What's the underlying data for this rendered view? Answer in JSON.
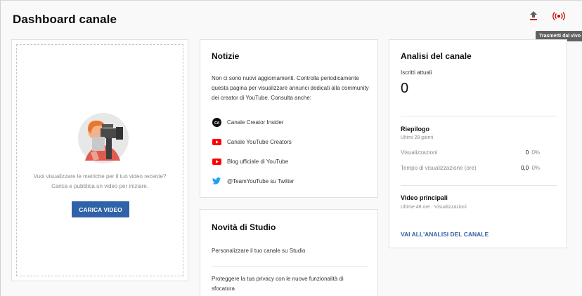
{
  "header": {
    "title": "Dashboard canale",
    "upload_icon": "upload-icon",
    "live_icon": "live-broadcast-icon",
    "tooltip": "Trasmetti dal vivo"
  },
  "video_card": {
    "empty_line1": "Vuoi visualizzare le metriche per il tuo video recente?",
    "empty_line2": "Carica e pubblica un video per iniziare.",
    "upload_button": "CARICA VIDEO"
  },
  "news_card": {
    "title": "Notizie",
    "body": "Non ci sono nuovi aggiornamenti. Controlla periodicamente questa pagina per visualizzare annunci dedicati alla community dei creator di YouTube. Consulta anche:",
    "links": [
      {
        "label": "Canale Creator Insider",
        "icon": "creator-insider-icon"
      },
      {
        "label": "Canale YouTube Creators",
        "icon": "youtube-icon"
      },
      {
        "label": "Blog ufficiale di YouTube",
        "icon": "youtube-icon"
      },
      {
        "label": "@TeamYouTube su Twitter",
        "icon": "twitter-icon"
      }
    ]
  },
  "studio_card": {
    "title": "Novità di Studio",
    "items": [
      "Personalizzare il tuo canale su Studio",
      "Proteggere la tua privacy con le nuove funzionalità di sfocatura"
    ]
  },
  "analytics_card": {
    "title": "Analisi del canale",
    "subscribers_label": "Iscritti attuali",
    "subscribers_value": "0",
    "summary_title": "Riepilogo",
    "summary_period": "Ultimi 28 giorni",
    "rows": [
      {
        "label": "Visualizzazioni",
        "value": "0",
        "pct": "0%"
      },
      {
        "label": "Tempo di visualizzazione (ore)",
        "value": "0,0",
        "pct": "0%"
      }
    ],
    "top_videos_title": "Video principali",
    "top_videos_sub": "Ultime 48 ore · Visualizzazioni",
    "link": "VAI ALL'ANALISI DEL CANALE"
  },
  "colors": {
    "accent": "#2f62a8",
    "youtube_red": "#ff0000",
    "twitter_blue": "#1da1f2",
    "live_red": "#cc0000"
  }
}
